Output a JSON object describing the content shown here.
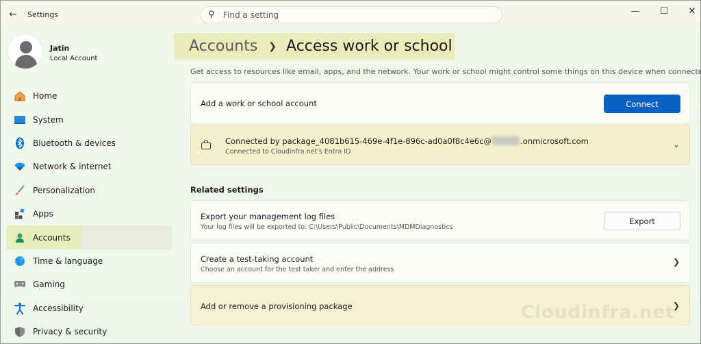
{
  "window": {
    "title": "Settings",
    "back_icon": "back-arrow-icon",
    "controls": [
      "minimize-icon",
      "maximize-icon",
      "close-icon"
    ]
  },
  "search": {
    "placeholder": "Find a setting"
  },
  "user": {
    "name": "Jatin",
    "account_type": "Local Account"
  },
  "nav": {
    "items": [
      {
        "label": "Home",
        "icon": "home-icon"
      },
      {
        "label": "System",
        "icon": "system-icon"
      },
      {
        "label": "Bluetooth & devices",
        "icon": "bluetooth-icon"
      },
      {
        "label": "Network & internet",
        "icon": "wifi-icon"
      },
      {
        "label": "Personalization",
        "icon": "brush-icon"
      },
      {
        "label": "Apps",
        "icon": "apps-icon"
      },
      {
        "label": "Accounts",
        "icon": "accounts-icon",
        "active": true
      },
      {
        "label": "Time & language",
        "icon": "globe-icon"
      },
      {
        "label": "Gaming",
        "icon": "gamepad-icon"
      },
      {
        "label": "Accessibility",
        "icon": "accessibility-icon"
      },
      {
        "label": "Privacy & security",
        "icon": "shield-icon"
      }
    ]
  },
  "page": {
    "breadcrumb_parent": "Accounts",
    "breadcrumb_current": "Access work or school",
    "description": "Get access to resources like email, apps, and the network. Your work or school might control some things on this device when connected."
  },
  "add_account": {
    "label": "Add a work or school account",
    "button": "Connect"
  },
  "connection": {
    "title_prefix": "Connected by package_4081b615-469e-4f1e-896c-ad0a0f8c4e6c@",
    "title_suffix": ".onmicrosoft.com",
    "subtitle": "Connected to Cloudinfra.net's Entra ID"
  },
  "related": {
    "title": "Related settings",
    "export": {
      "title": "Export your management log files",
      "subtitle": "Your log files will be exported to: C:\\Users\\Public\\Documents\\MDMDiagnostics",
      "button": "Export"
    },
    "test_account": {
      "title": "Create a test-taking account",
      "subtitle": "Choose an account for the test taker and enter the address"
    },
    "provisioning": {
      "title": "Add or remove a provisioning package"
    }
  },
  "watermark": "Cloudinfra.net",
  "colors": {
    "accent": "#0a5fc2",
    "highlight": "#e8edbb"
  }
}
